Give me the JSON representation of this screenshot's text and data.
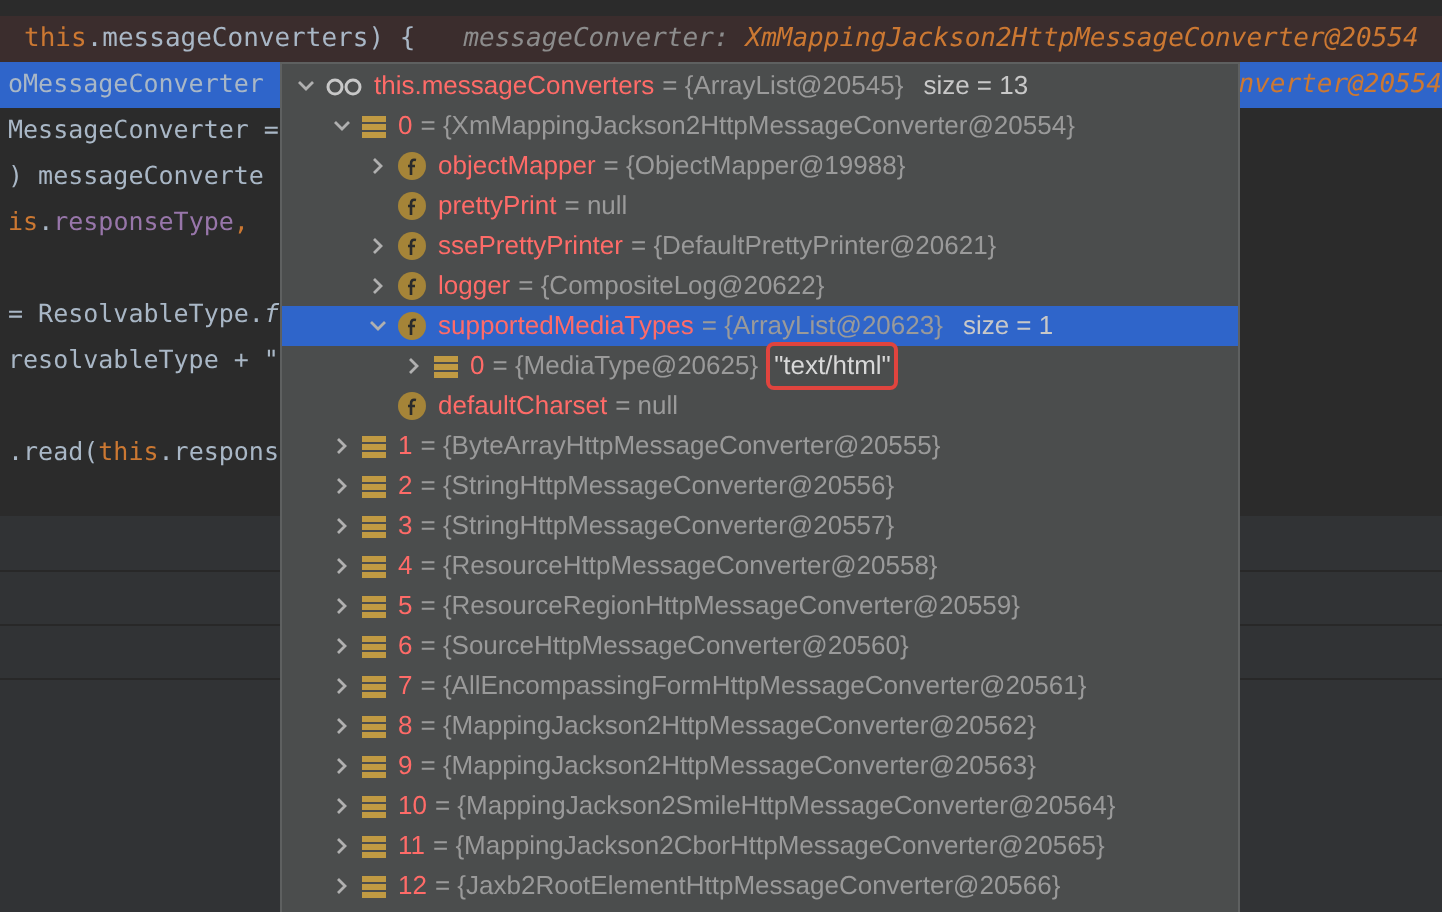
{
  "editor": {
    "lines": [
      {
        "kind": "breakpoint",
        "segments": [
          {
            "kind": "keyword",
            "text": "this"
          },
          {
            "kind": "text",
            "text": ".messageConverters) {"
          }
        ],
        "hint": {
          "label": "messageConverter:",
          "value": "XmMappingJackson2HttpMessageConverter@20554"
        }
      },
      {
        "kind": "selected",
        "segments": [
          {
            "kind": "text",
            "text": "oMessageConverter"
          }
        ],
        "hint": {
          "value": "nverter@20554"
        }
      },
      {
        "kind": "normal",
        "segments": [
          {
            "kind": "text",
            "text": "MessageConverter ="
          }
        ]
      },
      {
        "kind": "normal",
        "segments": [
          {
            "kind": "text",
            "text": ") messageConverte"
          }
        ]
      },
      {
        "kind": "normal",
        "segments": [
          {
            "kind": "keyword",
            "text": "is"
          },
          {
            "kind": "text",
            "text": "."
          },
          {
            "kind": "field",
            "text": "responseType"
          },
          {
            "kind": "keyword",
            "text": ","
          }
        ]
      },
      {
        "kind": "blank"
      },
      {
        "kind": "normal",
        "segments": [
          {
            "kind": "text",
            "text": "= ResolvableType."
          },
          {
            "kind": "method",
            "text": "f"
          }
        ]
      },
      {
        "kind": "normal",
        "segments": [
          {
            "kind": "text",
            "text": "resolvableType + \""
          }
        ]
      },
      {
        "kind": "blank"
      },
      {
        "kind": "normal",
        "segments": [
          {
            "kind": "text",
            "text": ".read("
          },
          {
            "kind": "keyword",
            "text": "this"
          },
          {
            "kind": "text",
            "text": ".respons"
          }
        ]
      }
    ]
  },
  "popup": {
    "tree": [
      {
        "kind": "watch",
        "name": "this.messageConverters",
        "value": "= {ArrayList@20545}",
        "extra": "size = 13",
        "expanded": true,
        "selected": false,
        "children": [
          {
            "kind": "item",
            "name": "0",
            "value": "= {XmMappingJackson2HttpMessageConverter@20554}",
            "expanded": true,
            "selected": false,
            "children": [
              {
                "kind": "field",
                "name": "objectMapper",
                "value": "= {ObjectMapper@19988}",
                "expanded": false,
                "selected": false
              },
              {
                "kind": "field",
                "name": "prettyPrint",
                "value": "= null",
                "selected": false
              },
              {
                "kind": "field",
                "name": "ssePrettyPrinter",
                "value": "= {DefaultPrettyPrinter@20621}",
                "expanded": false,
                "selected": false
              },
              {
                "kind": "field",
                "name": "logger",
                "value": "= {CompositeLog@20622}",
                "expanded": false,
                "selected": false
              },
              {
                "kind": "field",
                "name": "supportedMediaTypes",
                "value": "= {ArrayList@20623}",
                "extra": "size = 1",
                "expanded": true,
                "selected": true,
                "children": [
                  {
                    "kind": "item",
                    "name": "0",
                    "value": "= {MediaType@20625}",
                    "annotation": "\"text/html\"",
                    "highlighted": true,
                    "expanded": false,
                    "selected": false
                  }
                ]
              },
              {
                "kind": "field",
                "name": "defaultCharset",
                "value": "= null",
                "selected": false
              }
            ]
          },
          {
            "kind": "item",
            "name": "1",
            "value": "= {ByteArrayHttpMessageConverter@20555}",
            "expanded": false,
            "selected": false
          },
          {
            "kind": "item",
            "name": "2",
            "value": "= {StringHttpMessageConverter@20556}",
            "expanded": false,
            "selected": false
          },
          {
            "kind": "item",
            "name": "3",
            "value": "= {StringHttpMessageConverter@20557}",
            "expanded": false,
            "selected": false
          },
          {
            "kind": "item",
            "name": "4",
            "value": "= {ResourceHttpMessageConverter@20558}",
            "expanded": false,
            "selected": false
          },
          {
            "kind": "item",
            "name": "5",
            "value": "= {ResourceRegionHttpMessageConverter@20559}",
            "expanded": false,
            "selected": false
          },
          {
            "kind": "item",
            "name": "6",
            "value": "= {SourceHttpMessageConverter@20560}",
            "expanded": false,
            "selected": false
          },
          {
            "kind": "item",
            "name": "7",
            "value": "= {AllEncompassingFormHttpMessageConverter@20561}",
            "expanded": false,
            "selected": false
          },
          {
            "kind": "item",
            "name": "8",
            "value": "= {MappingJackson2HttpMessageConverter@20562}",
            "expanded": false,
            "selected": false
          },
          {
            "kind": "item",
            "name": "9",
            "value": "= {MappingJackson2HttpMessageConverter@20563}",
            "expanded": false,
            "selected": false
          },
          {
            "kind": "item",
            "name": "10",
            "value": "= {MappingJackson2SmileHttpMessageConverter@20564}",
            "expanded": false,
            "selected": false
          },
          {
            "kind": "item",
            "name": "11",
            "value": "= {MappingJackson2CborHttpMessageConverter@20565}",
            "expanded": false,
            "selected": false
          },
          {
            "kind": "item",
            "name": "12",
            "value": "= {Jaxb2RootElementHttpMessageConverter@20566}",
            "expanded": false,
            "selected": false
          }
        ]
      }
    ]
  }
}
